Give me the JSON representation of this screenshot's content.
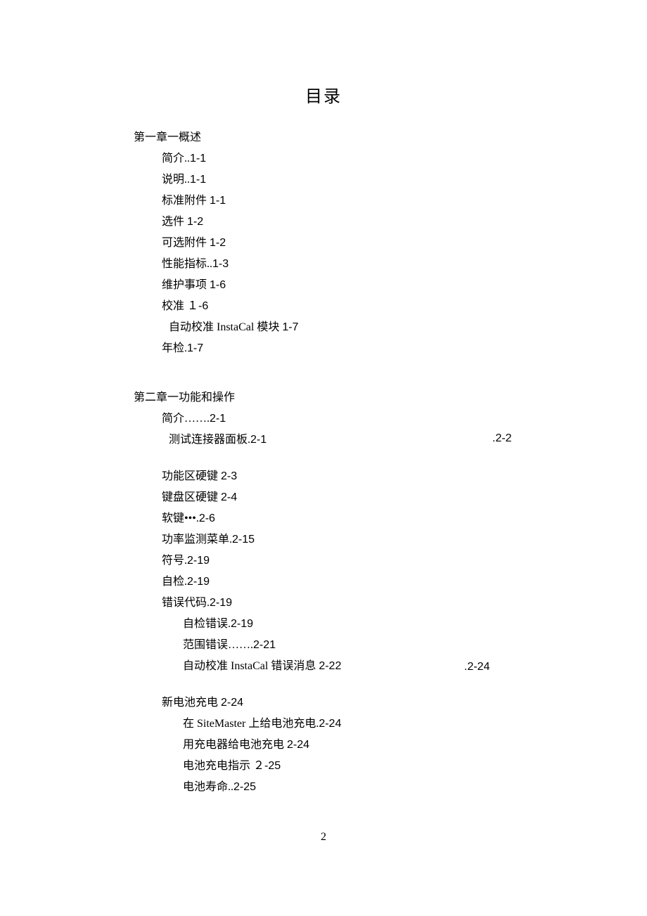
{
  "title": "目录",
  "chapter1": {
    "header": "第一章一概述",
    "entries": [
      {
        "label": "简介",
        "sep": "..",
        "page": "1-1"
      },
      {
        "label": "说明",
        "sep": "..",
        "page": "1-1"
      },
      {
        "label": "标准附件",
        "sep": " ",
        "page": "1-1"
      },
      {
        "label": "选件",
        "sep": " ",
        "page": "1-2"
      },
      {
        "label": "可选附件",
        "sep": " ",
        "page": "1-2"
      },
      {
        "label": "性能指标",
        "sep": "..",
        "page": "1-3"
      },
      {
        "label": "维护事项",
        "sep": " ",
        "page": "1-6"
      },
      {
        "label": "校准",
        "sep": " ",
        "page": "１-6"
      },
      {
        "label": "自动校准 InstaCal 模块",
        "sep": " ",
        "page": "1-7"
      },
      {
        "label": "年检",
        "sep": ".",
        "page": "1-7"
      }
    ]
  },
  "chapter2": {
    "header": "第二章一功能和操作",
    "block1": [
      {
        "label": "简介",
        "sep": "…….",
        "page": "2-1"
      },
      {
        "label": "测试连接器面板",
        "sep": ".",
        "page": "2-1"
      }
    ],
    "floating1": ".2-2",
    "block2": [
      {
        "label": "功能区硬键",
        "sep": " ",
        "page": "2-3"
      },
      {
        "label": "键盘区硬键",
        "sep": " ",
        "page": "2-4"
      },
      {
        "label": "软键",
        "sep": "•••.",
        "page": "2-6"
      },
      {
        "label": "功率监测菜单",
        "sep": ".",
        "page": "2-15"
      },
      {
        "label": "符号",
        "sep": ".",
        "page": "2-19"
      },
      {
        "label": "自检",
        "sep": ".",
        "page": "2-19"
      },
      {
        "label": "错误代码",
        "sep": ".",
        "page": "2-19"
      },
      {
        "label": "自检错误",
        "sep": ".",
        "page": "2-19"
      },
      {
        "label": "范围错误",
        "sep": "…….",
        "page": "2-21"
      },
      {
        "label": "自动校准 InstaCal 错误消息",
        "sep": " ",
        "page": "2-22"
      }
    ],
    "floating2": ".2-24",
    "block3": [
      {
        "label": "新电池充电",
        "sep": " ",
        "page": "2-24"
      },
      {
        "label": "在 SiteMaster 上给电池充电",
        "sep": ".",
        "page": "2-24"
      },
      {
        "label": "用充电器给电池充电",
        "sep": " ",
        "page": "2-24"
      },
      {
        "label": "电池充电指示",
        "sep": " ",
        "page": "２-25"
      },
      {
        "label": "电池寿命",
        "sep": "..",
        "page": "2-25"
      }
    ]
  },
  "page_number": "2"
}
